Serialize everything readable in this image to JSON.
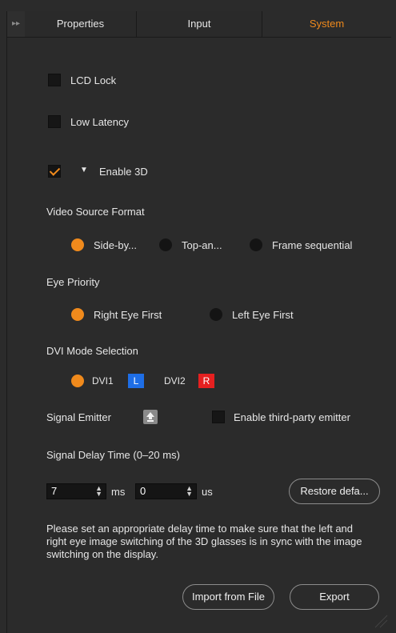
{
  "tabs": {
    "properties": "Properties",
    "input": "Input",
    "system": "System"
  },
  "options": {
    "lcd_lock": "LCD Lock",
    "low_latency": "Low Latency",
    "enable_3d": "Enable 3D"
  },
  "video_source": {
    "title": "Video Source Format",
    "opt1": "Side-by...",
    "opt2": "Top-an...",
    "opt3": "Frame sequential",
    "selected": "Side-by..."
  },
  "eye_priority": {
    "title": "Eye Priority",
    "opt1": "Right Eye First",
    "opt2": "Left Eye First",
    "selected": "Right Eye First"
  },
  "dvi_mode": {
    "title": "DVI Mode Selection",
    "dvi1": "DVI1",
    "dvi1_badge": "L",
    "dvi2": "DVI2",
    "dvi2_badge": "R"
  },
  "emitter": {
    "label": "Signal Emitter",
    "third_party": "Enable third-party emitter"
  },
  "delay": {
    "title": "Signal Delay Time (0–20 ms)",
    "ms_value": "7",
    "ms_unit": "ms",
    "us_value": "0",
    "us_unit": "us",
    "restore": "Restore defa..."
  },
  "info_text": "Please set an appropriate delay time to make sure that the left and right eye image switching of the 3D glasses is in sync with the image switching on the display.",
  "actions": {
    "import": "Import from File",
    "export": "Export"
  },
  "colors": {
    "accent": "#f08a1c",
    "badge_l": "#1e6ee6",
    "badge_r": "#e62020"
  },
  "icons": {
    "collapse": "double-chevron-right-icon",
    "expand": "triangle-down-icon",
    "emitter": "upload-icon"
  }
}
